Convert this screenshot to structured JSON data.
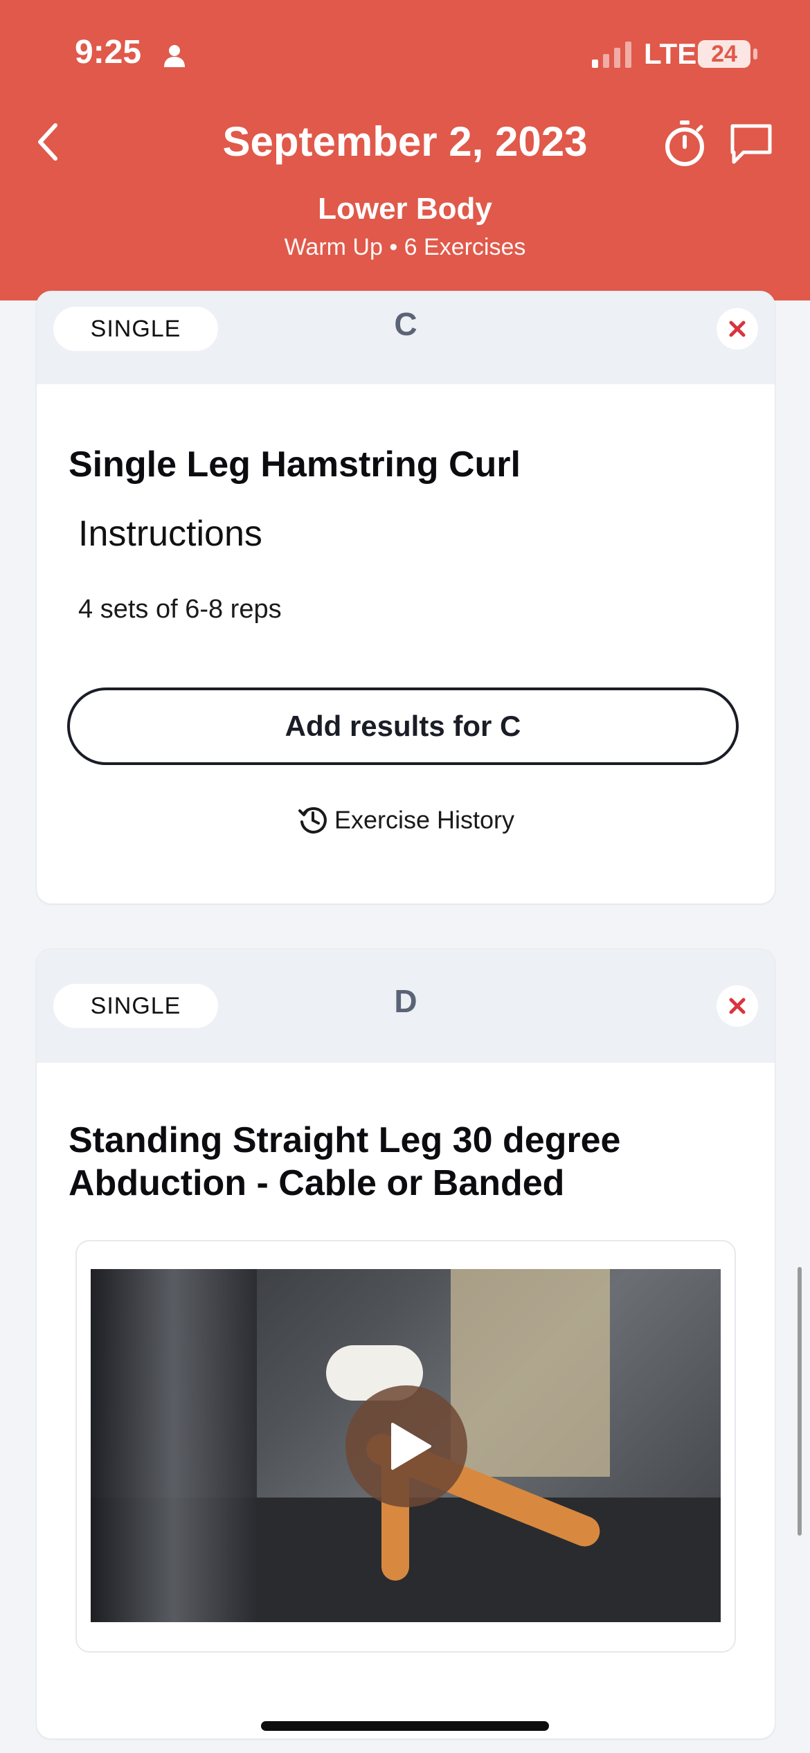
{
  "status_bar": {
    "time": "9:25",
    "network": "LTE",
    "battery": "24"
  },
  "header": {
    "date": "September 2, 2023",
    "title": "Lower Body",
    "subtitle": "Warm Up • 6 Exercises",
    "accent_color": "#e0594a"
  },
  "cards": [
    {
      "type_label": "SINGLE",
      "letter": "C",
      "exercise_title": "Single Leg Hamstring Curl",
      "instructions_title": "Instructions",
      "instructions_text": "4 sets of 6-8 reps",
      "add_results_label": "Add results for C",
      "history_label": "Exercise History"
    },
    {
      "type_label": "SINGLE",
      "letter": "D",
      "exercise_title_line1": "Standing Straight Leg 30 degree",
      "exercise_title_line2": "Abduction - Cable or Banded"
    }
  ],
  "icons": [
    "person-icon",
    "back-chevron-icon",
    "timer-icon",
    "chat-icon",
    "close-icon",
    "history-icon",
    "play-icon"
  ]
}
